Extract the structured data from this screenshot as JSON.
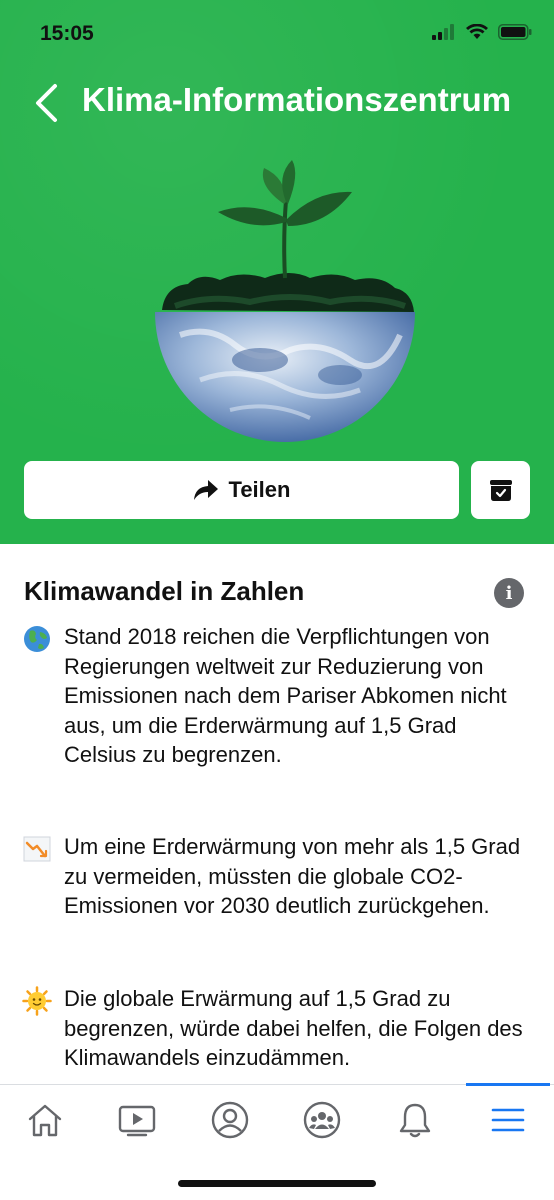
{
  "status_bar": {
    "time": "15:05"
  },
  "header": {
    "title": "Klima-Informationszentrum"
  },
  "actions": {
    "share_label": "Teilen"
  },
  "section": {
    "title": "Klimawandel in Zahlen",
    "facts": [
      {
        "icon": "globe-emoji",
        "text": "Stand 2018 reichen die Verpflichtungen von Regierungen weltweit zur Reduzierung von Emissionen nach dem Pariser Abkomen nicht aus, um die Erderwärmung auf 1,5 Grad Celsius zu begrenzen."
      },
      {
        "icon": "chart-decreasing-emoji",
        "text": "Um eine Erderwärmung von mehr als 1,5 Grad zu vermeiden, müssten die globale CO2-Emissionen vor 2030 deutlich zurückgehen."
      },
      {
        "icon": "sun-emoji",
        "text": "Die globale Erwärmung auf 1,5 Grad zu begrenzen, würde dabei helfen, die Folgen des Klimawandels einzudämmen."
      }
    ]
  },
  "colors": {
    "hero_green": "#25b24c",
    "accent_blue": "#1877f2"
  },
  "bottom_nav": {
    "items": [
      "home-icon",
      "video-icon",
      "profile-icon",
      "groups-icon",
      "notifications-icon",
      "menu-icon"
    ],
    "active": "menu-icon"
  }
}
